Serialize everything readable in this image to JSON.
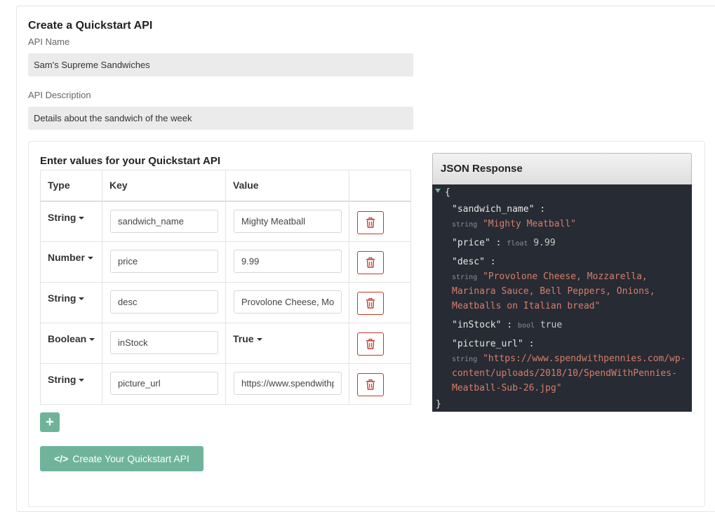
{
  "form": {
    "title": "Create a Quickstart API",
    "name_label": "API Name",
    "name_value": "Sam's Supreme Sandwiches",
    "desc_label": "API Description",
    "desc_value": "Details about the sandwich of the week"
  },
  "values_panel": {
    "title": "Enter values for your Quickstart API",
    "headers": [
      "Type",
      "Key",
      "Value",
      ""
    ],
    "rows": [
      {
        "type": "String",
        "key": "sandwich_name",
        "value": "Mighty Meatball",
        "value_kind": "input"
      },
      {
        "type": "Number",
        "key": "price",
        "value": "9.99",
        "value_kind": "input"
      },
      {
        "type": "String",
        "key": "desc",
        "value": "Provolone Cheese, Mozzarella, Marinara Sauce, Bell Peppers, Onions, Meatballs on Italian bread",
        "value_kind": "input"
      },
      {
        "type": "Boolean",
        "key": "inStock",
        "value": "True",
        "value_kind": "dropdown"
      },
      {
        "type": "String",
        "key": "picture_url",
        "value": "https://www.spendwithpennies.com/wp-content/uploads/2018/10/SpendWithPennies-Meatball-Sub-26.jpg",
        "value_kind": "input"
      }
    ],
    "add_label": "+",
    "create_label": "Create Your Quickstart API",
    "create_icon": "</>",
    "delete_icon": "trash-icon"
  },
  "json_panel": {
    "title": "JSON Response",
    "open_brace": "{",
    "close_brace": "}",
    "sandwich_name_key": "\"sandwich_name\" :",
    "sandwich_name_type": "string",
    "sandwich_name_val": "\"Mighty Meatball\"",
    "price_key": "\"price\" :",
    "price_type": "float",
    "price_val": "9.99",
    "desc_key": "\"desc\" :",
    "desc_type": "string",
    "desc_val_1": "\"Provolone Cheese, Mozzarella,",
    "desc_val_2": "Marinara Sauce, Bell Peppers, Onions,",
    "desc_val_3": "Meatballs on Italian bread\"",
    "instock_key": "\"inStock\" :",
    "instock_type": "bool",
    "instock_val": "true",
    "pic_key": "\"picture_url\" :",
    "pic_type": "string",
    "pic_val_1": "\"https://www.spendwithpennies.com/wp-",
    "pic_val_2": "content/uploads/2018/10/SpendWithPennies-",
    "pic_val_3": "Meatball-Sub-26.jpg\""
  },
  "colors": {
    "accent": "#6fb49a",
    "delete": "#c0392b",
    "json_bg": "#272b33",
    "json_string": "#d77e6c"
  }
}
